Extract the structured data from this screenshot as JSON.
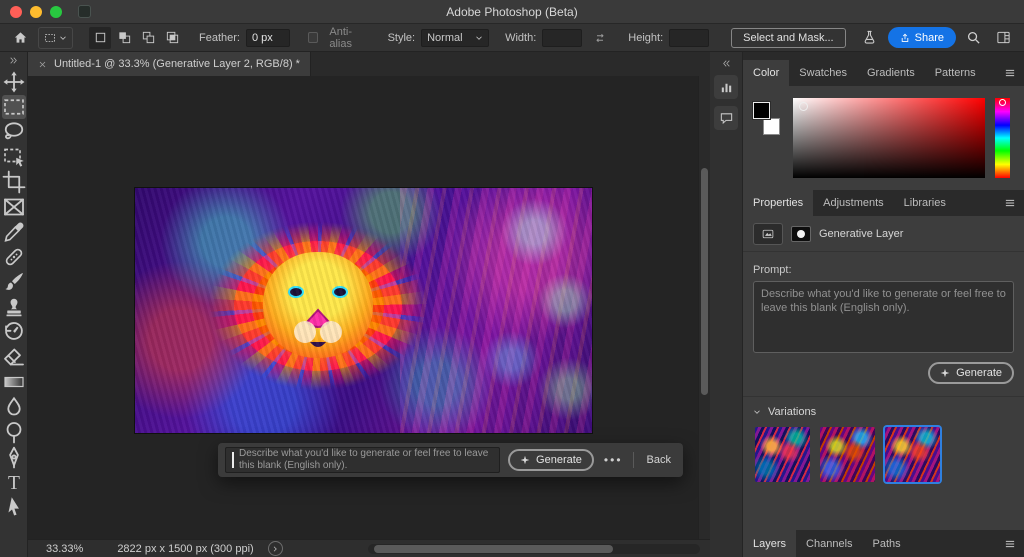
{
  "titlebar": {
    "title": "Adobe Photoshop (Beta)"
  },
  "options_bar": {
    "feather_label": "Feather:",
    "feather_value": "0 px",
    "anti_alias_label": "Anti-alias",
    "style_label": "Style:",
    "style_value": "Normal",
    "width_label": "Width:",
    "width_value": "",
    "height_label": "Height:",
    "height_value": "",
    "select_and_mask_label": "Select and Mask...",
    "share_label": "Share"
  },
  "toolbar": {
    "tools": [
      {
        "name": "move"
      },
      {
        "name": "rectangular-marquee",
        "active": true
      },
      {
        "name": "lasso"
      },
      {
        "name": "object-selection"
      },
      {
        "name": "crop"
      },
      {
        "name": "frame"
      },
      {
        "name": "eyedropper"
      },
      {
        "name": "spot-healing-brush"
      },
      {
        "name": "brush"
      },
      {
        "name": "clone-stamp"
      },
      {
        "name": "history-brush"
      },
      {
        "name": "eraser"
      },
      {
        "name": "gradient"
      },
      {
        "name": "blur"
      },
      {
        "name": "dodge"
      },
      {
        "name": "pen"
      },
      {
        "name": "type"
      },
      {
        "name": "path-selection"
      }
    ]
  },
  "document": {
    "tab_title": "Untitled-1 @ 33.3% (Generative Layer 2, RGB/8) *",
    "zoom": "33.33%",
    "dimensions": "2822 px x 1500 px (300 ppi)"
  },
  "prompt_bar": {
    "placeholder": "Describe what you'd like to generate or feel free to leave this blank (English only).",
    "generate_label": "Generate",
    "back_label": "Back"
  },
  "panels": {
    "color": {
      "tabs": [
        "Color",
        "Swatches",
        "Gradients",
        "Patterns"
      ],
      "active_tab": "Color"
    },
    "properties": {
      "tabs": [
        "Properties",
        "Adjustments",
        "Libraries"
      ],
      "active_tab": "Properties",
      "layer_name": "Generative Layer",
      "prompt_label": "Prompt:",
      "prompt_placeholder": "Describe what you'd like to generate or feel free to leave this blank (English only).",
      "generate_label": "Generate",
      "variations_label": "Variations",
      "variations_count": 3,
      "selected_variation": 3
    },
    "bottom": {
      "tabs": [
        "Layers",
        "Channels",
        "Paths"
      ],
      "active_tab": "Layers"
    }
  },
  "colors": {
    "accent_blue": "#1473e6",
    "selection_border": "#2f80e0",
    "traffic_close": "#ff5f57",
    "traffic_minimize": "#febc2e",
    "traffic_zoom": "#28c840"
  }
}
